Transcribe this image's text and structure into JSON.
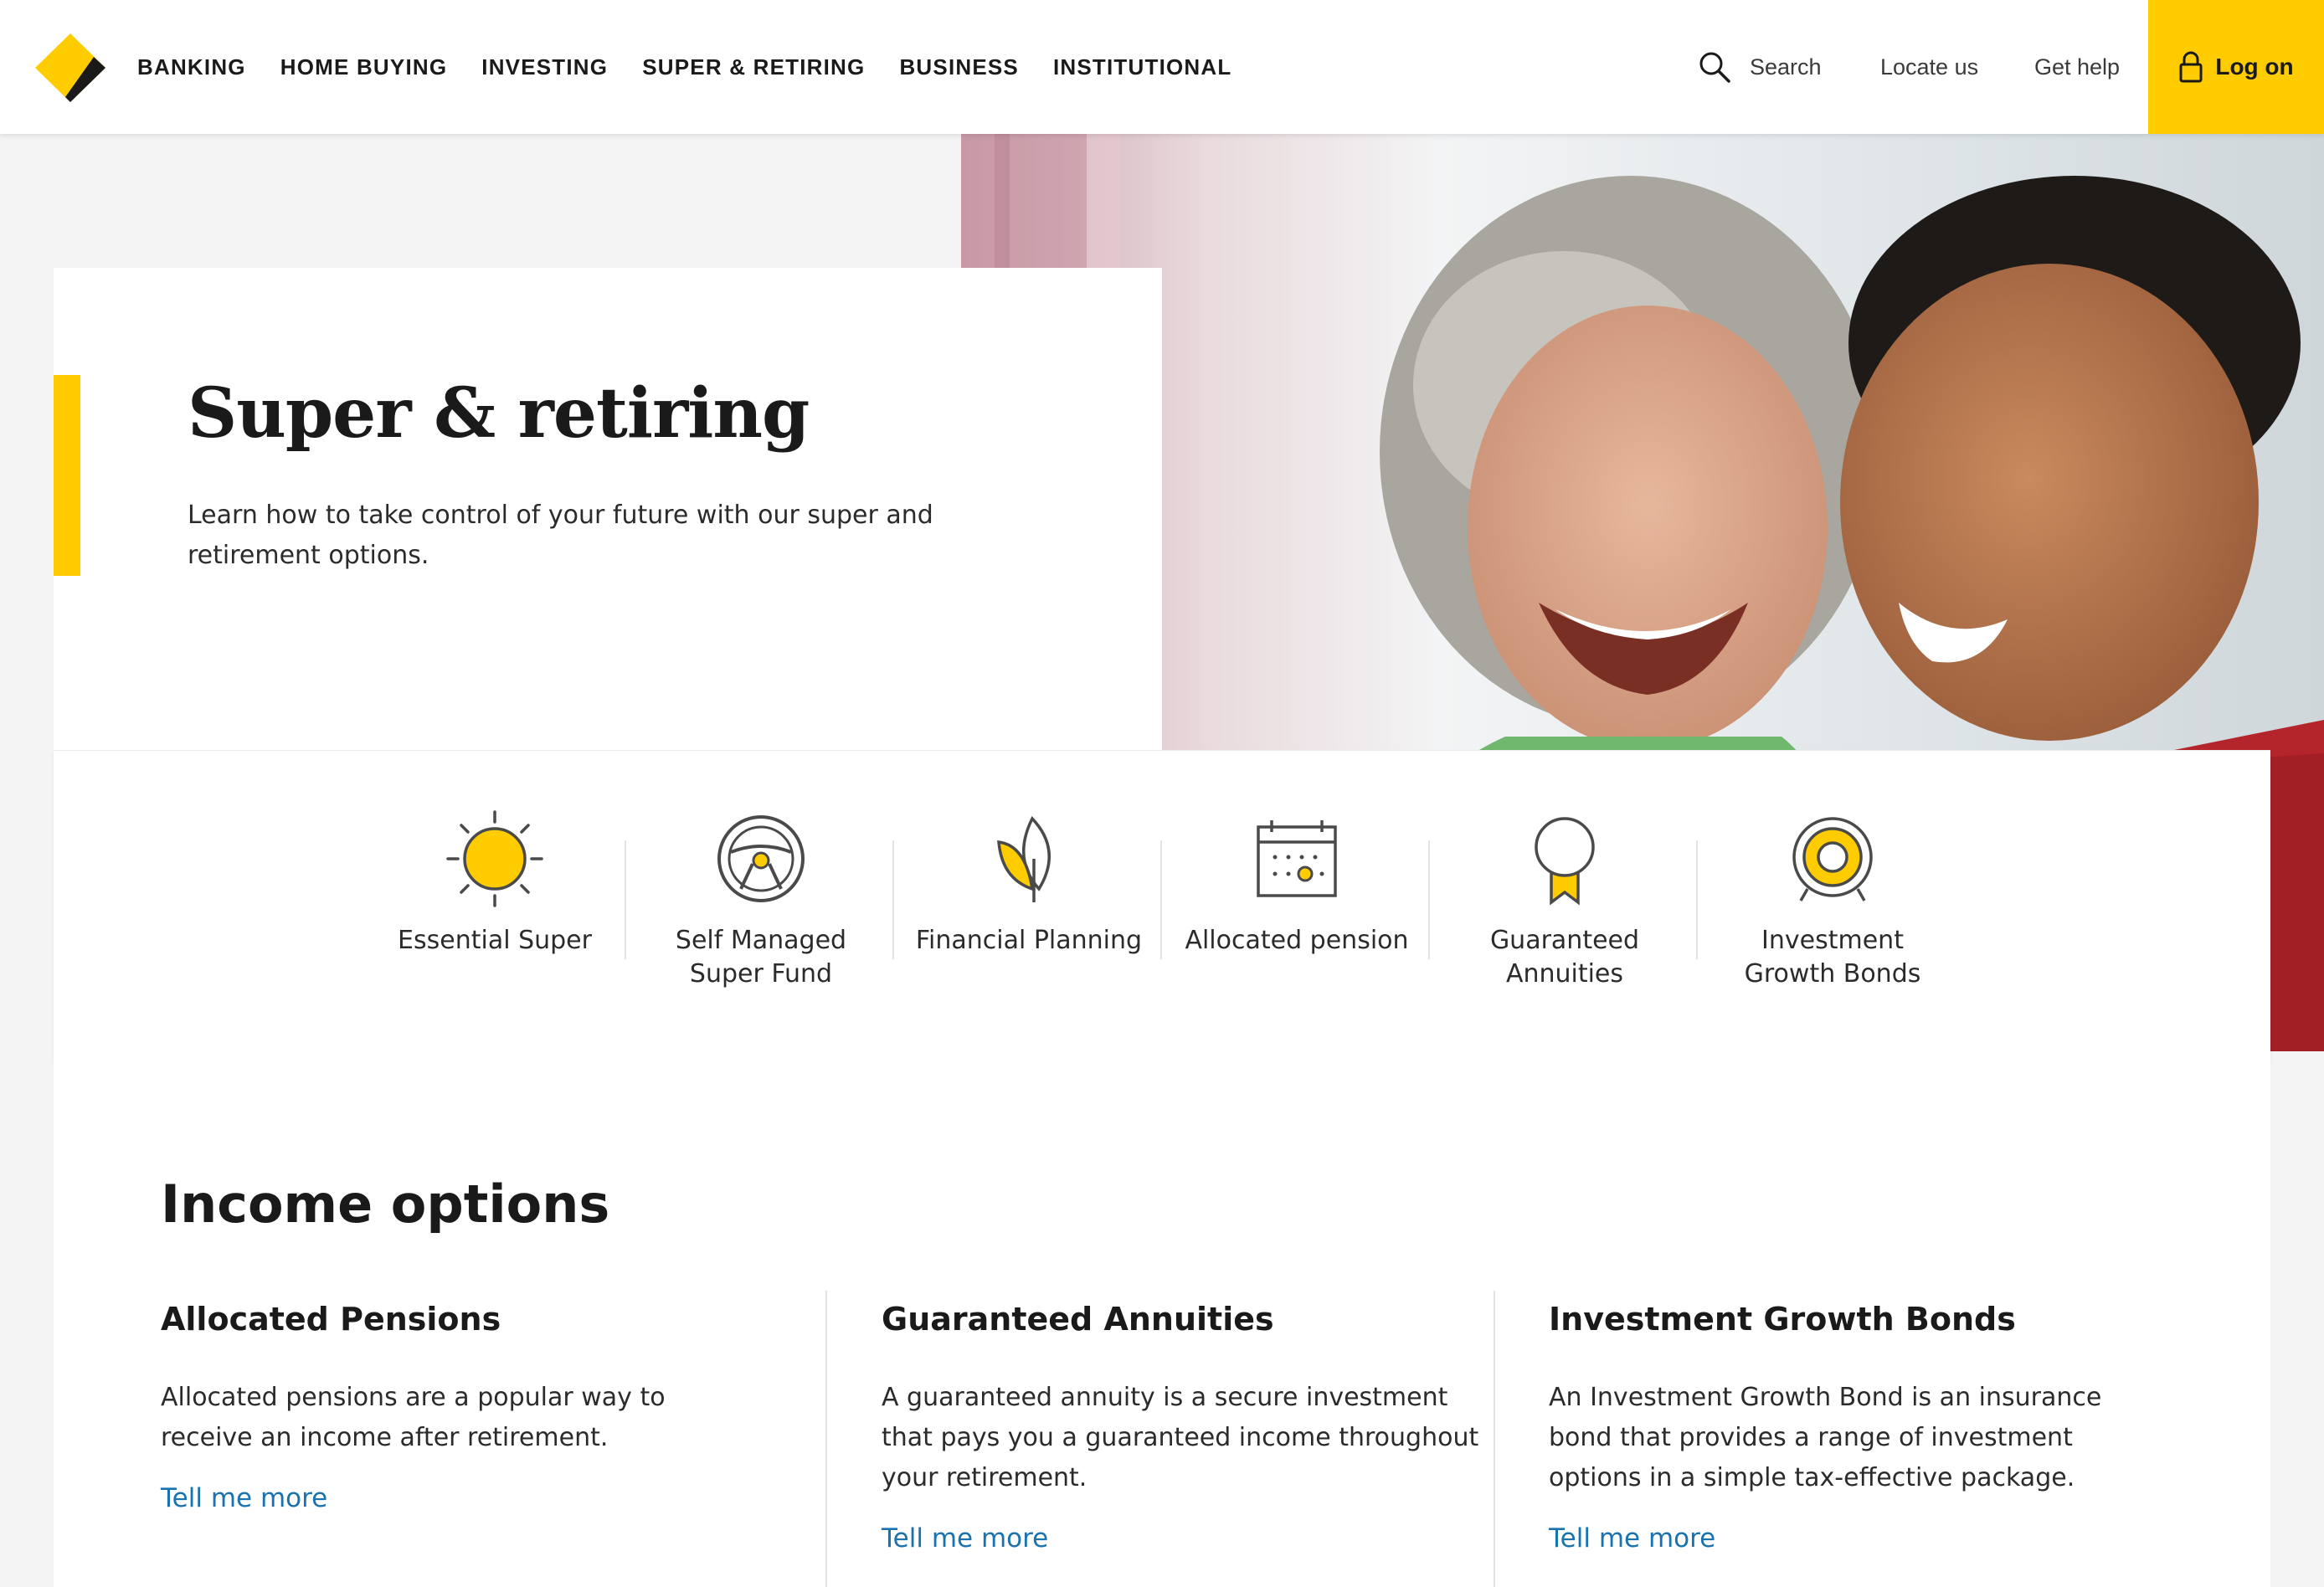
{
  "header": {
    "logo": "commbank-diamond-logo",
    "nav": [
      "BANKING",
      "HOME BUYING",
      "INVESTING",
      "SUPER & RETIRING",
      "BUSINESS",
      "INSTITUTIONAL"
    ],
    "search_label": "Search",
    "locate_label": "Locate us",
    "help_label": "Get help",
    "logon_label": "Log on",
    "accent_color": "#ffcc00"
  },
  "hero": {
    "title": "Super & retiring",
    "description": "Learn how to take control of your future with our super and retirement options.",
    "image": "smiling-senior-couple-photo"
  },
  "quick_links": [
    {
      "label": "Essential Super",
      "icon": "sun-icon"
    },
    {
      "label": "Self Managed\nSuper Fund",
      "icon": "steering-wheel-icon"
    },
    {
      "label": "Financial Planning",
      "icon": "leaf-icon"
    },
    {
      "label": "Allocated pension",
      "icon": "calendar-icon"
    },
    {
      "label": "Guaranteed\nAnnuities",
      "icon": "award-ribbon-icon"
    },
    {
      "label": "Investment\nGrowth Bonds",
      "icon": "target-icon"
    }
  ],
  "income": {
    "title": "Income options",
    "columns": [
      {
        "title": "Allocated Pensions",
        "text": "Allocated pensions are a popular way to receive an income after retirement.",
        "link": "Tell me more"
      },
      {
        "title": "Guaranteed Annuities",
        "text": "A guaranteed annuity is a secure investment that pays you a guaranteed income throughout your retirement.",
        "link": "Tell me more"
      },
      {
        "title": "Investment Growth Bonds",
        "text": "An Investment Growth Bond is an insurance bond that provides a range of investment options in a simple tax-effective package.",
        "link": "Tell me more"
      }
    ]
  }
}
